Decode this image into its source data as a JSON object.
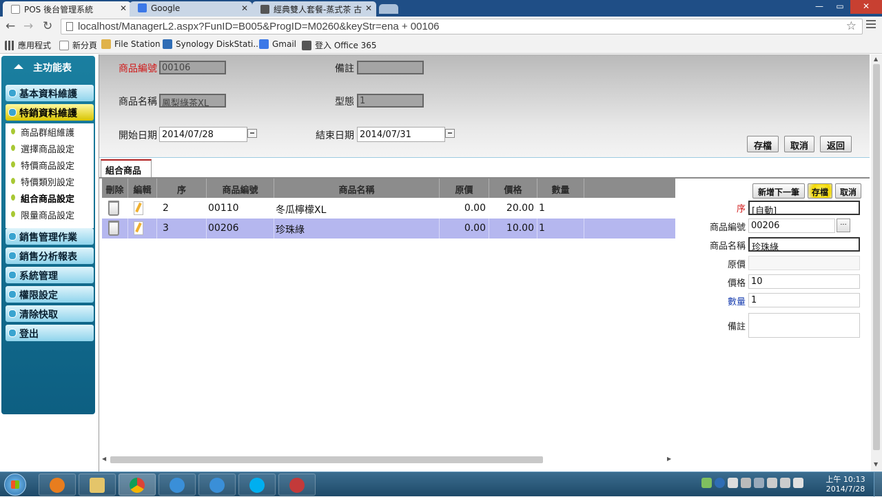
{
  "browser": {
    "tabs": [
      {
        "title": "POS 後台管理系統",
        "favicon": "page-icon"
      },
      {
        "title": "Google",
        "favicon": "google-icon"
      },
      {
        "title": "經典雙人套餐-蒸式茶 古",
        "favicon": "chain-link-icon"
      }
    ],
    "url": "localhost/ManagerL2.aspx?FunID=B005&ProgID=M0260&keyStr=ena + 00106",
    "bookmarks": [
      {
        "label": "應用程式",
        "icon": "apps-grid-icon"
      },
      {
        "label": "新分頁",
        "icon": "page-icon"
      },
      {
        "label": "File Station",
        "icon": "folder-icon"
      },
      {
        "label": "Synology DiskStati...",
        "icon": "synology-icon"
      },
      {
        "label": "Gmail",
        "icon": "google-icon"
      },
      {
        "label": "登入 Office 365",
        "icon": "office-icon"
      }
    ]
  },
  "sidebar": {
    "home_label": "主功能表",
    "modules": [
      {
        "label": "基本資料維護",
        "active": false
      },
      {
        "label": "特銷資料維護",
        "active": true
      },
      {
        "label": "銷售管理作業",
        "active": false
      },
      {
        "label": "銷售分析報表",
        "active": false
      },
      {
        "label": "系統管理",
        "active": false
      },
      {
        "label": "權限設定",
        "active": false
      },
      {
        "label": "清除快取",
        "active": false
      },
      {
        "label": "登出",
        "active": false
      }
    ],
    "sub_items": [
      {
        "label": "商品群組維護",
        "bold": false
      },
      {
        "label": "選擇商品設定",
        "bold": false
      },
      {
        "label": "特價商品設定",
        "bold": false
      },
      {
        "label": "特價類別設定",
        "bold": false
      },
      {
        "label": "組合商品設定",
        "bold": true
      },
      {
        "label": "限量商品設定",
        "bold": false
      }
    ]
  },
  "form": {
    "product_code_label": "商品編號",
    "product_code_value": "00106",
    "note_label": "備註",
    "note_value": "",
    "product_name_label": "商品名稱",
    "product_name_value": "鳳梨綠茶XL",
    "model_label": "型態",
    "model_value": "1",
    "start_date_label": "開始日期",
    "start_date_value": "2014/07/28",
    "end_date_label": "結束日期",
    "end_date_value": "2014/07/31",
    "save_label": "存檔",
    "cancel_label": "取消",
    "back_label": "返回"
  },
  "section_tab_label": "組合商品",
  "grid": {
    "headers": [
      "刪除",
      "編輯",
      "序",
      "商品編號",
      "商品名稱",
      "原價",
      "價格",
      "數量"
    ],
    "rows": [
      {
        "seq": "2",
        "code": "00110",
        "name": "冬瓜檸檬XL",
        "orig_price": "0.00",
        "price": "20.00",
        "qty": "1",
        "selected": false
      },
      {
        "seq": "3",
        "code": "00206",
        "name": "珍珠綠",
        "orig_price": "0.00",
        "price": "10.00",
        "qty": "1",
        "selected": true
      }
    ]
  },
  "side_form": {
    "add_next_label": "新增下一筆",
    "save_label": "存檔",
    "cancel_label": "取消",
    "seq_label": "序",
    "seq_value": "[自動]",
    "code_label": "商品編號",
    "code_value": "00206",
    "lookup_label": "...",
    "name_label": "商品名稱",
    "name_value": "珍珠綠",
    "orig_price_label": "原價",
    "orig_price_value": "",
    "price_label": "價格",
    "price_value": "10",
    "qty_label": "數量",
    "qty_value": "1",
    "note_label": "備註"
  },
  "taskbar": {
    "time": "上午 10:13",
    "date": "2014/7/28"
  },
  "colors": {
    "accent_red": "#d01818",
    "selection": "#b5b7ef",
    "nav_blue": "#0d5f82",
    "active_module": "#d8c400"
  }
}
